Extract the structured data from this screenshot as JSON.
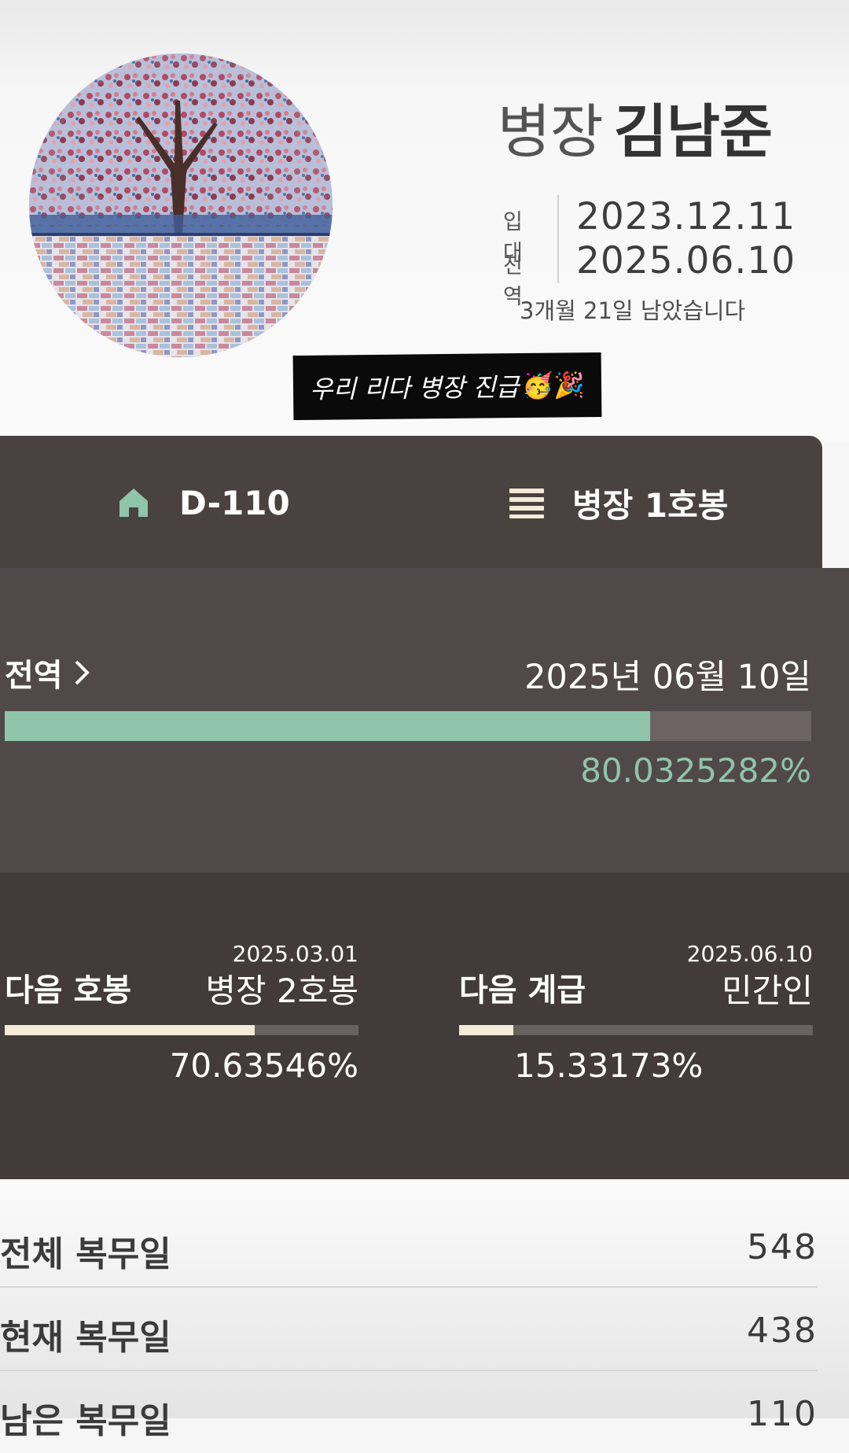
{
  "profile": {
    "rank": "병장",
    "name": "김남준",
    "enlist_label": "입대",
    "enlist_date": "2023.12.11",
    "discharge_label": "전역",
    "discharge_date": "2025.06.10",
    "remaining_text": "3개월 21일 남았습니다"
  },
  "sticker": {
    "text": "우리 리다 병장 진급",
    "emoji": "🥳🎉"
  },
  "tabs": {
    "dday_label": "D-110",
    "rank_label": "병장 1호봉",
    "dday_icon": "home-icon",
    "rank_icon": "menu-icon"
  },
  "discharge": {
    "label": "전역",
    "date": "2025년 06월 10일",
    "percent": "80.0325282%",
    "progress": 0.800325282
  },
  "next_step": {
    "title": "다음 호봉",
    "date": "2025.03.01",
    "target": "병장 2호봉",
    "percent": "70.63546%",
    "progress": 0.7063546
  },
  "next_rank": {
    "title": "다음 계급",
    "date": "2025.06.10",
    "target": "민간인",
    "percent": "15.33173%",
    "progress": 0.1533173
  },
  "stats": [
    {
      "label": "전체 복무일",
      "value": "548"
    },
    {
      "label": "현재 복무일",
      "value": "438"
    },
    {
      "label": "남은 복무일",
      "value": "110"
    }
  ],
  "colors": {
    "accent_green": "#8fc5ab",
    "panel_dark": "#433b3b",
    "panel_mid": "#514949",
    "cream": "#f4ecd6"
  }
}
